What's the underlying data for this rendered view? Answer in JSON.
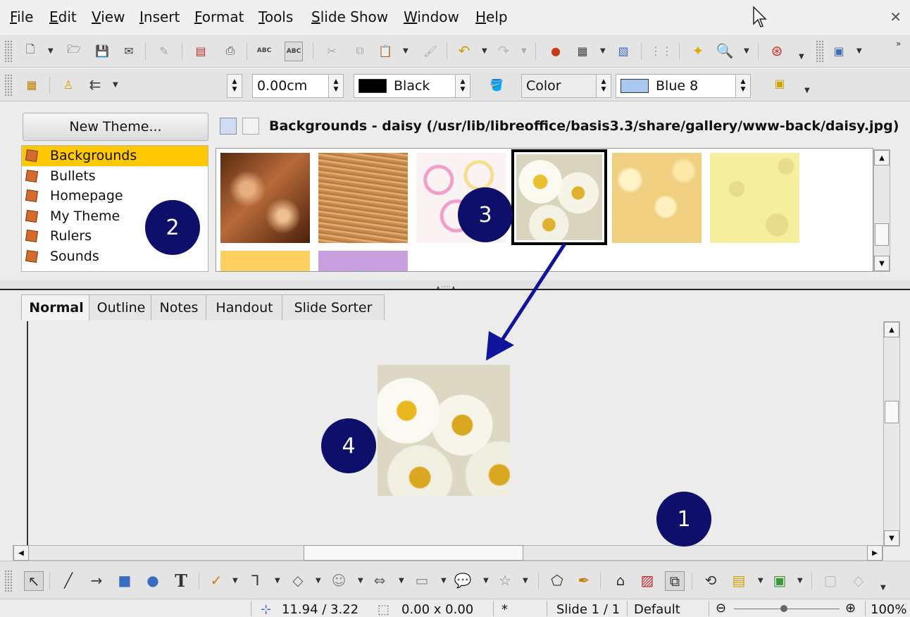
{
  "menu": [
    "File",
    "Edit",
    "View",
    "Insert",
    "Format",
    "Tools",
    "Slide Show",
    "Window",
    "Help"
  ],
  "line_toolbar": {
    "line_width": "0.00cm",
    "line_color": "Black",
    "area_style": "Color",
    "area_color": "Blue 8"
  },
  "colors": {
    "line_color": "#000000",
    "area_color": "#a8c8f0",
    "selection": "#ffc800",
    "badge": "#0d0f6a"
  },
  "gallery": {
    "new_theme_label": "New Theme...",
    "title": "Backgrounds - daisy (/usr/lib/libreoffice/basis3.3/share/gallery/www-back/daisy.jpg)",
    "themes": [
      "Backgrounds",
      "Bullets",
      "Homepage",
      "My Theme",
      "Rulers",
      "Sounds"
    ],
    "selected_theme": "Backgrounds",
    "thumbnails": [
      "chocolate",
      "wood",
      "circles",
      "daisy",
      "popcorn",
      "cheese",
      "orange",
      "candy"
    ],
    "selected_thumbnail": "daisy"
  },
  "view_tabs": [
    "Normal",
    "Outline",
    "Notes",
    "Handout",
    "Slide Sorter"
  ],
  "active_tab": "Normal",
  "callouts": [
    "1",
    "2",
    "3",
    "4"
  ],
  "status": {
    "position": "11.94 / 3.22",
    "size": "0.00 x 0.00",
    "modified": "*",
    "slide": "Slide 1 / 1",
    "master": "Default",
    "zoom": "100%"
  }
}
